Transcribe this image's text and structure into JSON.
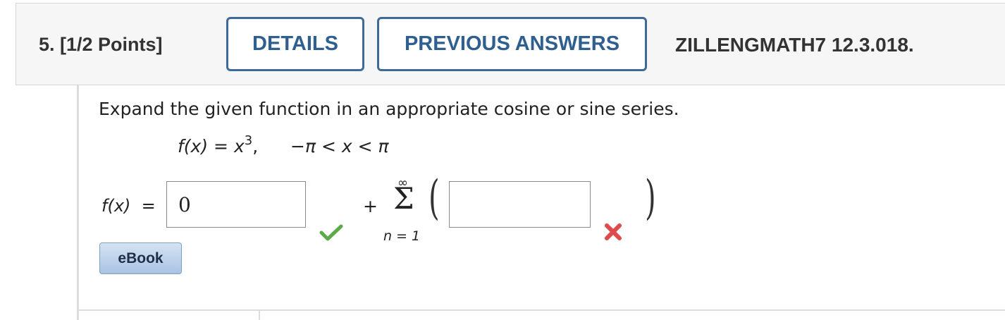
{
  "header": {
    "question_label": "5. [1/2 Points]",
    "details_label": "DETAILS",
    "previous_answers_label": "PREVIOUS ANSWERS",
    "question_code": "ZILLENGMATH7 12.3.018."
  },
  "question": {
    "prompt": "Expand the given function in an appropriate cosine or sine series.",
    "function_lhs": "f(x) = x",
    "function_exponent": "3",
    "function_comma": ",",
    "domain_minus": "−",
    "domain_pi": "π",
    "domain_lt1": " < ",
    "domain_var": "x",
    "domain_lt2": " < ",
    "domain_pi2": "π"
  },
  "answer": {
    "fx_label": "f(x)  =",
    "input_a_value": "0",
    "input_a_status": "correct",
    "plus": "+",
    "sigma_upper": "∞",
    "sigma_symbol": "Σ",
    "sigma_lower": "n = 1",
    "paren_left": "(",
    "paren_right": ")",
    "input_b_value": "",
    "input_b_status": "incorrect"
  },
  "ebook_label": "eBook",
  "icons": {
    "correct": "checkmark-icon",
    "incorrect": "x-mark-icon"
  },
  "colors": {
    "accent": "#3d6a9a",
    "correct": "#4caf50",
    "incorrect": "#e04a4a"
  }
}
